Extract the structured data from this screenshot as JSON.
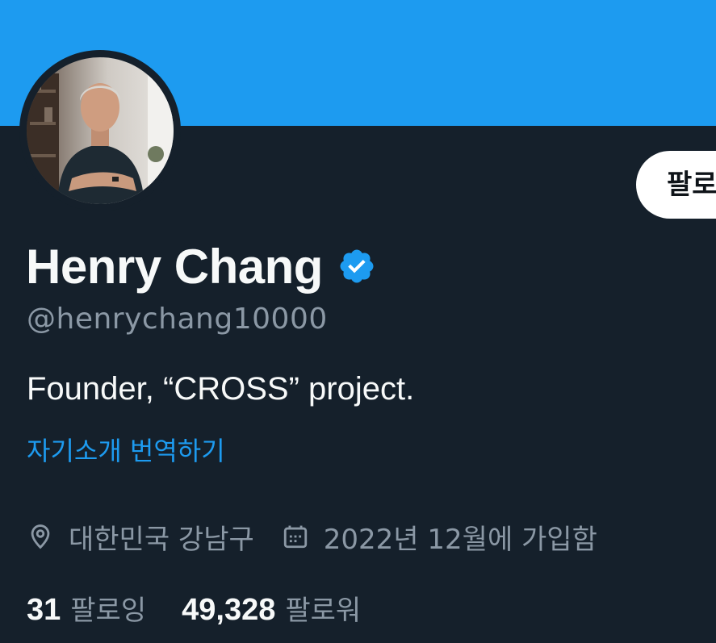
{
  "profile": {
    "display_name": "Henry Chang",
    "handle": "@henrychang10000",
    "bio": "Founder, “CROSS” project.",
    "translate_bio": "자기소개 번역하기",
    "verified_icon": "verified-badge-icon",
    "location": "대한민국 강남구",
    "location_icon": "location-pin-icon",
    "joined": "2022년 12월에 가입함",
    "joined_icon": "calendar-icon"
  },
  "actions": {
    "follow_label": "팔로우"
  },
  "stats": {
    "following_count": "31",
    "following_label": "팔로잉",
    "followers_count": "49,328",
    "followers_label": "팔로워"
  },
  "colors": {
    "banner": "#1d9bf0",
    "background": "#15202b",
    "primary_text": "#f7f9f9",
    "secondary_text": "#8b98a5",
    "link": "#1d9bf0"
  }
}
